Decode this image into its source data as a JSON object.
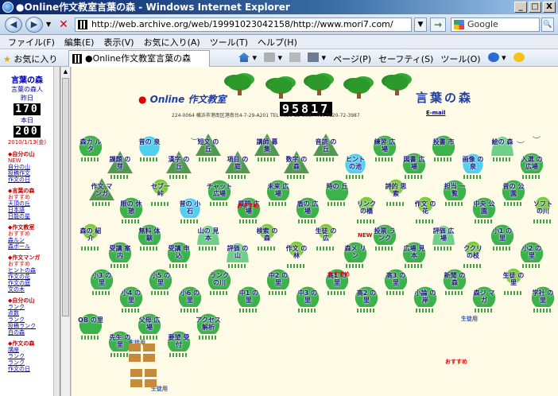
{
  "window": {
    "title": "●Online作文教室言葉の森 - Windows Internet Explorer",
    "min": "_",
    "max": "□",
    "close": "X"
  },
  "address": {
    "url": "http://web.archive.org/web/19991023042158/http://www.mori7.com/",
    "search_placeholder": "Google"
  },
  "menu": [
    "ファイル(F)",
    "編集(E)",
    "表示(V)",
    "お気に入り(A)",
    "ツール(T)",
    "ヘルプ(H)"
  ],
  "toolbar": {
    "favorites_label": "お気に入り",
    "tab_title": "●Online作文教室言葉の森",
    "commands": [
      "ページ(P)",
      "セーフティ(S)",
      "ツール(O)"
    ]
  },
  "sidebar": {
    "title": "言葉の森",
    "subtitle": "言葉の森人",
    "yesterday_label": "昨日",
    "yesterday_count": "170",
    "today_label": "本日",
    "today_count": "200",
    "date": "2010/1/13(金)",
    "sections": [
      {
        "heading": "◆自分の山",
        "links": [
          "NEW",
          "自分の山",
          "投稿作文",
          "作文の日"
        ]
      },
      {
        "heading": "◆言葉の森",
        "links": [
          "おすすめ",
          "天頂の丘",
          "日本語",
          "日能の星"
        ]
      },
      {
        "heading": "◆作文教室",
        "links": [
          "おすすめ",
          "森ルン",
          "森ポール"
        ]
      },
      {
        "heading": "◆作文マンガ",
        "links": [
          "おすすめ",
          "ヒントの森",
          "作文の花",
          "作文の庭",
          "文の木"
        ]
      },
      {
        "heading": "◆自分の山",
        "links": [
          "ランク",
          "点数",
          "ランク",
          "投稿ランク",
          "白の森"
        ]
      },
      {
        "heading": "◆作文の森",
        "links": [
          "講座",
          "ランク",
          "ランク",
          "作文の日"
        ]
      }
    ]
  },
  "header": {
    "brand": "Online 作文教室",
    "brand_jp": "言葉の森",
    "counter": "95817",
    "address_line": "224-0064 横浜市港南区港南台4-7-29-A201  TEL 0120-22-3987 FAX 0120-72-3987",
    "email_link": "E-mail"
  },
  "map_cells": [
    {
      "label": "森カ ルタ",
      "shape": "bush"
    },
    {
      "label": "課題 の芽",
      "shape": "mountain"
    },
    {
      "label": "昔の 泉",
      "shape": "pond"
    },
    {
      "label": "漢字 の丘",
      "shape": "mountain"
    },
    {
      "label": "短文 の丘",
      "shape": "mountain"
    },
    {
      "label": "項目 の庭",
      "shape": "mountain"
    },
    {
      "label": "講師 募集",
      "shape": "mountain"
    },
    {
      "label": "数字 の森",
      "shape": "mountain"
    },
    {
      "label": "音読 の丘",
      "shape": "mountain"
    },
    {
      "label": "ヒント の池",
      "shape": "pond"
    },
    {
      "label": "練習 広場",
      "shape": "bush"
    },
    {
      "label": "図書 広場",
      "shape": "bush"
    },
    {
      "label": "投書 市",
      "shape": "bush"
    },
    {
      "label": "画像 の泉",
      "shape": "pond"
    },
    {
      "label": "絵の 森",
      "shape": "hill"
    },
    {
      "label": "入選 の広場",
      "shape": "bush"
    },
    {
      "label": "作文 マンガ",
      "shape": "mountain"
    },
    {
      "label": "眼の 休憩",
      "shape": "bush"
    },
    {
      "label": "セブー 峠",
      "shape": "tree"
    },
    {
      "label": "昔の 小石",
      "shape": "pond"
    },
    {
      "label": "チャット 広場",
      "shape": "bush"
    },
    {
      "label": "質問 広場",
      "shape": "bush"
    },
    {
      "label": "未来 広場",
      "shape": "bush"
    },
    {
      "label": "盾の 広場",
      "shape": "bush"
    },
    {
      "label": "時の 丘",
      "shape": "bush"
    },
    {
      "label": "リンク の橋",
      "shape": "tree"
    },
    {
      "label": "詩的 思索",
      "shape": "tree"
    },
    {
      "label": "作文 の花",
      "shape": "tree"
    },
    {
      "label": "担当 一覧",
      "shape": "bush"
    },
    {
      "label": "中央 公園",
      "shape": "bush"
    },
    {
      "label": "昔の 公園",
      "shape": "bush"
    },
    {
      "label": "ソフト の川",
      "shape": "tree"
    },
    {
      "label": "森の 紹介",
      "shape": "tree"
    },
    {
      "label": "受講 案内",
      "shape": "bush"
    },
    {
      "label": "無料 体験",
      "shape": "bush"
    },
    {
      "label": "受講 申込",
      "shape": "bush"
    },
    {
      "label": "山の 見本",
      "shape": "hill"
    },
    {
      "label": "評価 の山",
      "shape": "hill"
    },
    {
      "label": "検索 の森",
      "shape": "tree"
    },
    {
      "label": "作文 の林",
      "shape": "tree"
    },
    {
      "label": "生徒 の広",
      "shape": "tree"
    },
    {
      "label": "森メ リン",
      "shape": "bush"
    },
    {
      "label": "投票 ランク",
      "shape": "bush"
    },
    {
      "label": "広場 見本",
      "shape": "bush"
    },
    {
      "label": "評価 広場",
      "shape": "hill"
    },
    {
      "label": "ククリ の枝",
      "shape": "tree"
    },
    {
      "label": "小1 の里",
      "shape": "bush"
    },
    {
      "label": "小2 の里",
      "shape": "bush"
    },
    {
      "label": "小3 の里",
      "shape": "bush"
    },
    {
      "label": "小4 の里",
      "shape": "bush"
    },
    {
      "label": "小5 の里",
      "shape": "bush"
    },
    {
      "label": "小6 の里",
      "shape": "bush"
    },
    {
      "label": "ランク の川",
      "shape": "bush"
    },
    {
      "label": "中1 の里",
      "shape": "bush"
    },
    {
      "label": "中2 の里",
      "shape": "bush"
    },
    {
      "label": "中3 の里",
      "shape": "bush"
    },
    {
      "label": "高1 の里",
      "shape": "bush"
    },
    {
      "label": "高2 の里",
      "shape": "bush"
    },
    {
      "label": "高3 の里",
      "shape": "bush"
    },
    {
      "label": "小論 の岸",
      "shape": "bush"
    },
    {
      "label": "新聞 の森",
      "shape": "bush"
    },
    {
      "label": "森ジ マガ",
      "shape": "bush"
    },
    {
      "label": "生徒 の里",
      "shape": "tree"
    },
    {
      "label": "学社 の里",
      "shape": "bush"
    },
    {
      "label": "OB の里",
      "shape": "bush"
    },
    {
      "label": "先生 の里",
      "shape": "bush"
    },
    {
      "label": "父母 広場",
      "shape": "bush"
    },
    {
      "label": "要望 受付",
      "shape": "bush"
    },
    {
      "label": "アクセス 解析",
      "shape": "bush"
    }
  ],
  "tags": {
    "new": "NEW",
    "recommend": "おすすめ",
    "student": "生徒用"
  }
}
